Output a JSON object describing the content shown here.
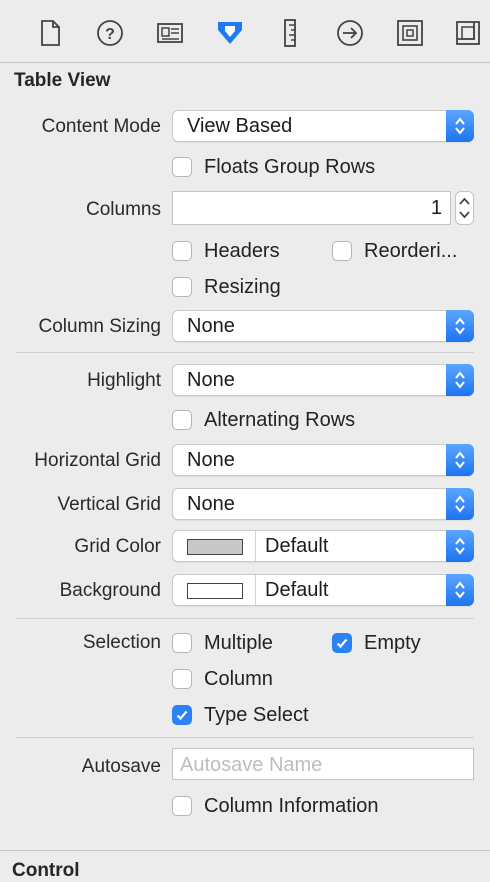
{
  "toolbar": {
    "icons": [
      "file-icon",
      "help-icon",
      "identity-icon",
      "attributes-icon",
      "size-icon",
      "connections-icon",
      "bindings-icon",
      "effects-icon"
    ]
  },
  "table_view": {
    "title": "Table View",
    "content_mode": {
      "label": "Content Mode",
      "value": "View Based"
    },
    "floats_group_rows": {
      "label": "Floats Group Rows",
      "checked": false
    },
    "columns": {
      "label": "Columns",
      "value": "1"
    },
    "headers": {
      "label": "Headers",
      "checked": false
    },
    "reordering": {
      "label": "Reorderi...",
      "checked": false
    },
    "resizing": {
      "label": "Resizing",
      "checked": false
    },
    "column_sizing": {
      "label": "Column Sizing",
      "value": "None"
    },
    "highlight": {
      "label": "Highlight",
      "value": "None"
    },
    "alternating_rows": {
      "label": "Alternating Rows",
      "checked": false
    },
    "horizontal_grid": {
      "label": "Horizontal Grid",
      "value": "None"
    },
    "vertical_grid": {
      "label": "Vertical Grid",
      "value": "None"
    },
    "grid_color": {
      "label": "Grid Color",
      "value": "Default",
      "swatch": "#c8c8c8"
    },
    "background": {
      "label": "Background",
      "value": "Default",
      "swatch": "#ffffff"
    },
    "selection": {
      "label": "Selection",
      "multiple": {
        "label": "Multiple",
        "checked": false
      },
      "empty": {
        "label": "Empty",
        "checked": true
      },
      "column": {
        "label": "Column",
        "checked": false
      },
      "type_select": {
        "label": "Type Select",
        "checked": true
      }
    },
    "autosave": {
      "label": "Autosave",
      "placeholder": "Autosave Name"
    },
    "column_information": {
      "label": "Column Information",
      "checked": false
    }
  },
  "control": {
    "title": "Control"
  },
  "colors": {
    "accent": "#2b82f7",
    "active_tab": "#1e7af0"
  }
}
